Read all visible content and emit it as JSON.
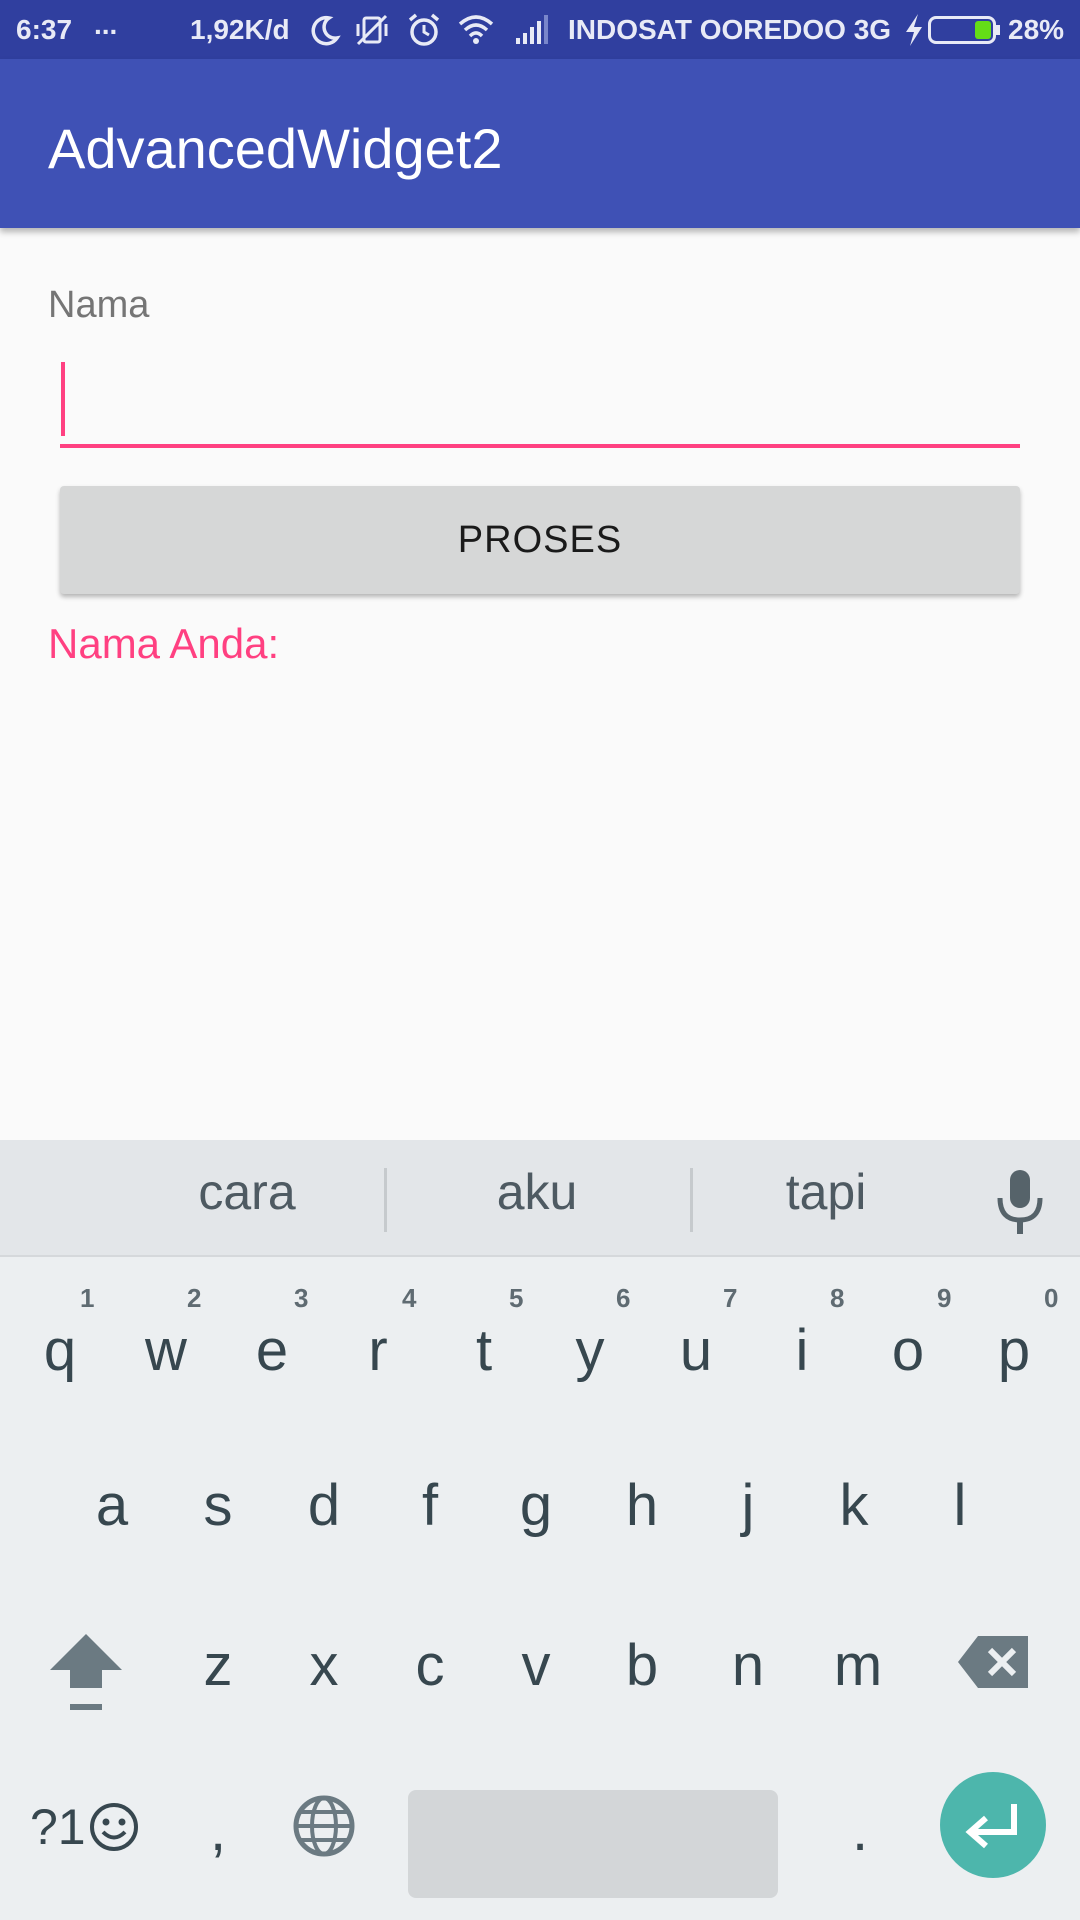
{
  "status_bar": {
    "time": "6:37",
    "more": "...",
    "speed": "1,92K/d",
    "carrier": "INDOSAT OOREDOO 3G",
    "battery_pct": "28%",
    "battery_level": 0.28,
    "icons": [
      "moon-icon",
      "vibrate-off-icon",
      "alarm-icon",
      "wifi-icon",
      "signal-icon",
      "charging-icon",
      "battery-icon"
    ]
  },
  "app_bar": {
    "title": "AdvancedWidget2"
  },
  "form": {
    "label": "Nama",
    "input_value": "",
    "button_label": "PROSES",
    "result_label": "Nama Anda:"
  },
  "keyboard": {
    "suggestions": [
      "cara",
      "aku",
      "tapi"
    ],
    "row1": [
      "q",
      "w",
      "e",
      "r",
      "t",
      "y",
      "u",
      "i",
      "o",
      "p"
    ],
    "row1_hints": [
      "1",
      "2",
      "3",
      "4",
      "5",
      "6",
      "7",
      "8",
      "9",
      "0"
    ],
    "row2": [
      "a",
      "s",
      "d",
      "f",
      "g",
      "h",
      "j",
      "k",
      "l"
    ],
    "row3": [
      "z",
      "x",
      "c",
      "v",
      "b",
      "n",
      "m"
    ],
    "symbols_label": "?1",
    "comma": ",",
    "period": "."
  },
  "colors": {
    "primary": "#3f51b5",
    "primary_dark": "#303f9f",
    "accent": "#ff4081",
    "enter_key": "#4db6ac"
  }
}
